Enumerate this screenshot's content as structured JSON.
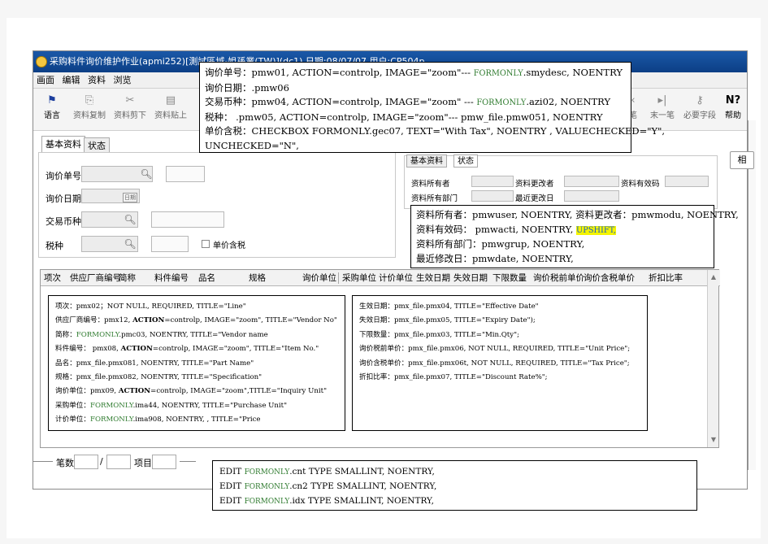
{
  "window": {
    "title": "采购料件询价维护作业(apmi252)[測試區域-姐孫業(TW)](dc1) 日期:08/07/07 用户:CP504p"
  },
  "menu": [
    "画面",
    "编辑",
    "资料",
    "浏览"
  ],
  "toolbar": {
    "left": [
      {
        "icon": "flag-icon",
        "label": "语言"
      },
      {
        "icon": "copy-icon",
        "label": "资料复制"
      },
      {
        "icon": "cut-icon",
        "label": "资料剪下"
      },
      {
        "icon": "paste-icon",
        "label": "资料贴上"
      }
    ],
    "right": [
      {
        "icon": "prev-icon",
        "label": "笔"
      },
      {
        "icon": "last-icon",
        "label": "末一笔"
      },
      {
        "icon": "key-icon",
        "label": "必要字段"
      },
      {
        "icon": "help-icon",
        "label": "帮助"
      }
    ]
  },
  "tabs": [
    "基本资料",
    "状态"
  ],
  "form": {
    "inquiry_no": "询价单号",
    "inquiry_date": "询价日期",
    "currency": "交易币种",
    "tax": "税种",
    "tax_inclusive": "单价含税",
    "calendar_label": "日期"
  },
  "status_panel": {
    "tabs": [
      "基本资料",
      "状态"
    ],
    "owner": "资料所有者",
    "modifier": "资料更改者",
    "valid": "资料有效码",
    "owner_dept": "资料所有部门",
    "last_modified": "最近更改日"
  },
  "side_button": "相",
  "grid": {
    "columns": [
      "项次",
      "供应厂商编号",
      "简称",
      "料件编号",
      "品名",
      "规格",
      "询价单位",
      "采购单位",
      "计价单位",
      "生效日期",
      "失效日期",
      "下限数量",
      "询价税前单价",
      "询价含税单价",
      "折扣比率"
    ]
  },
  "status_bar": {
    "count": "笔数",
    "slash": "/",
    "item": "项目"
  },
  "annotations": {
    "top": [
      {
        "a": "询价单号：pmw01, ACTION=controlp, IMAGE=\"zoom\"--- ",
        "f": "FORMONLY",
        "b": ".smydesc, NOENTRY"
      },
      {
        "a": "询价日期：.pmw06"
      },
      {
        "a": "交易币种：pmw04, ACTION=controlp, IMAGE=\"zoom\" --- ",
        "f": "FORMONLY",
        "b": ".azi02, NOENTRY"
      },
      {
        "a": "税种： .pmw05, ACTION=controlp, IMAGE=\"zoom\"--- pmw_file.pmw051, NOENTRY"
      },
      {
        "a": "单价含税：CHECKBOX    FORMONLY.gec07, TEXT=\"With Tax\", NOENTRY , VALUECHECKED=\"Y\","
      },
      {
        "a": "UNCHECKED=\"N\","
      }
    ],
    "status": [
      "资料所有者：pmwuser, NOENTRY, 资料更改者：pmwmodu, NOENTRY,",
      "资料有效码：  pmwacti, NOENTRY, ",
      "资料所有部门：pmwgrup, NOENTRY,",
      "最近修改日：pmwdate, NOENTRY,"
    ],
    "upshift": "UPSHIFT,",
    "left_grid": [
      {
        "a": "项次：pmx02；NOT NULL, REQUIRED, TITLE=\"Line\""
      },
      {
        "a": "供应厂商编号：pmx12, ",
        "k": "ACTION",
        "b": "=controlp, IMAGE=\"zoom\", TITLE=\"Vendor No\""
      },
      {
        "a": "简称：",
        "f": "FORMONLY",
        "b": ".pmc03, NOENTRY, TITLE=\"Vendor name"
      },
      {
        "a": "料件编号：  pmx08, ",
        "k": "ACTION",
        "b": "=controlp, IMAGE=\"zoom\", TITLE=\"Item No.\""
      },
      {
        "a": "品名：pmx_file.pmx081, NOENTRY, TITLE=\"Part Name\""
      },
      {
        "a": "规格：pmx_file.pmx082, NOENTRY, TITLE=\"Specification\""
      },
      {
        "a": "询价单位：pmx09, ",
        "k": "ACTION",
        "b": "=controlp, IMAGE=\"zoom\",TITLE=\"Inquiry Unit\""
      },
      {
        "a": "采购单位：",
        "f": "FORMONLY",
        "b": ".ima44, NOENTRY, TITLE=\"Purchase Unit\""
      },
      {
        "a": "计价单位：",
        "f": "FORMONLY",
        "b": ".ima908, NOENTRY, , TITLE=\"Price"
      }
    ],
    "right_grid": [
      "生效日期：pmx_file.pmx04, TITLE=\"Effective Date\"",
      "失效日期：pmx_file.pmx05,  TITLE=\"Expiry Date\");",
      "下限数量：pmx_file.pmx03, TITLE=\"Min.Qty\";",
      "询价税前单价：pmx_file.pmx06, NOT NULL, REQUIRED,  TITLE=\"Unit Price\";",
      "询价含税单价：pmx_file.pmx06t, NOT NULL, REQUIRED, TITLE=\"Tax Price\";",
      "折扣比率：pmx_file.pmx07, TITLE=\"Discount Rate%\";"
    ],
    "bottom": [
      {
        "a": "EDIT    ",
        "f": "FORMONLY",
        "b": ".cnt TYPE SMALLINT, NOENTRY,"
      },
      {
        "a": "EDIT    ",
        "f": "FORMONLY",
        "b": ".cn2 TYPE SMALLINT, NOENTRY,"
      },
      {
        "a": "EDIT    ",
        "f": "FORMONLY",
        "b": ".idx TYPE SMALLINT, NOENTRY,"
      }
    ]
  }
}
